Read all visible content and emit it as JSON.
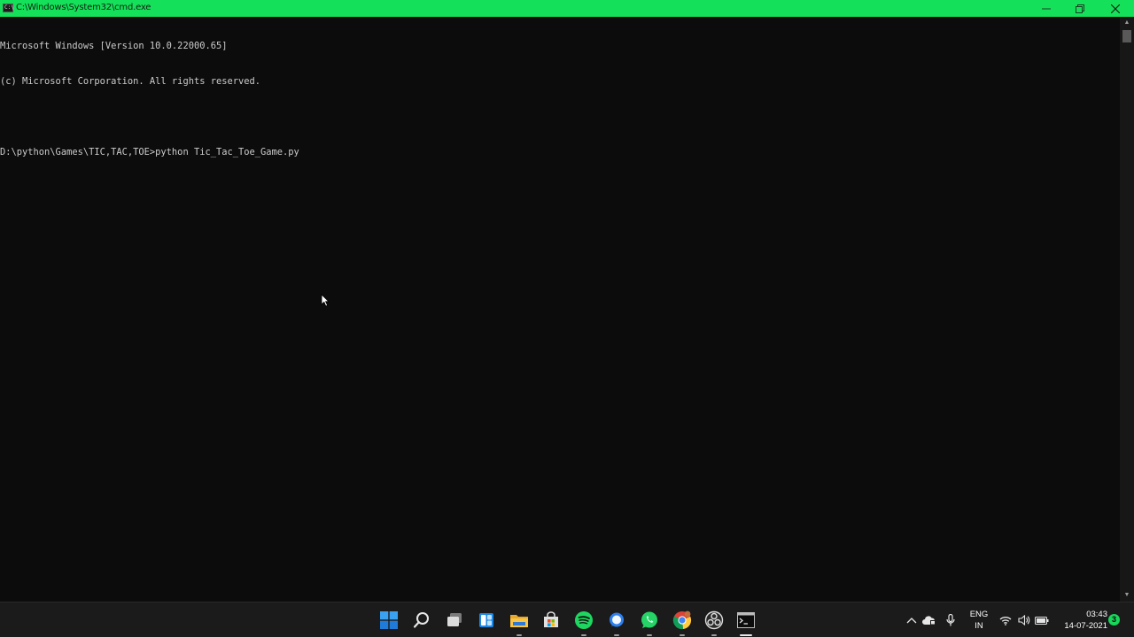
{
  "window": {
    "title": "C:\\Windows\\System32\\cmd.exe",
    "minimize_glyph": "—",
    "restore_glyph": "❐",
    "close_glyph": "✕",
    "titlebar_color": "#15e05a"
  },
  "console": {
    "lines": [
      "Microsoft Windows [Version 10.0.22000.65]",
      "(c) Microsoft Corporation. All rights reserved.",
      "",
      "D:\\python\\Games\\TIC,TAC,TOE>python Tic_Tac_Toe_Game.py"
    ],
    "text_color": "#cccccc",
    "background": "#0c0c0c"
  },
  "taskbar": {
    "apps": [
      {
        "name": "start-button",
        "icon": "windows-logo-icon",
        "running": false
      },
      {
        "name": "search-button",
        "icon": "search-icon",
        "running": false
      },
      {
        "name": "task-view-button",
        "icon": "task-view-icon",
        "running": false
      },
      {
        "name": "widgets-button",
        "icon": "widgets-icon",
        "running": false
      },
      {
        "name": "file-explorer-button",
        "icon": "folder-icon",
        "running": true
      },
      {
        "name": "store-button",
        "icon": "store-icon",
        "running": false
      },
      {
        "name": "spotify-button",
        "icon": "spotify-icon",
        "running": true
      },
      {
        "name": "messenger-button",
        "icon": "chat-bubble-icon",
        "running": true
      },
      {
        "name": "whatsapp-button",
        "icon": "whatsapp-icon",
        "running": true
      },
      {
        "name": "chrome-button",
        "icon": "chrome-icon",
        "running": true
      },
      {
        "name": "obs-button",
        "icon": "obs-icon",
        "running": true
      },
      {
        "name": "terminal-button",
        "icon": "terminal-icon",
        "running": true,
        "active": true
      }
    ],
    "tray": {
      "chevron": "^",
      "language_line1": "ENG",
      "language_line2": "IN",
      "time": "03:43",
      "date": "14-07-2021",
      "notification_count": "3"
    }
  }
}
